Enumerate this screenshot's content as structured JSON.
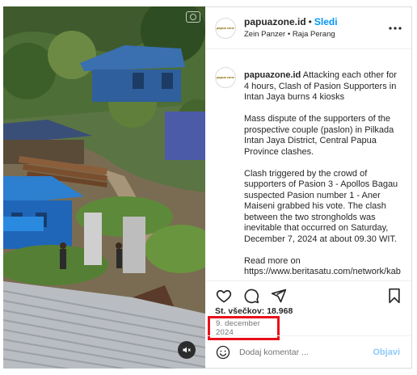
{
  "post": {
    "account": {
      "username": "papuazone.id",
      "follow_label": "Sledi",
      "separator": "•",
      "subline": "Zein Panzer • Raja Perang",
      "avatar_text": "papua zone"
    },
    "caption": {
      "username": "papuazone.id",
      "paragraphs": [
        "Attacking each other for 4 hours, Clash of Pasion Supporters in Intan Jaya burns 4 kiosks",
        "Mass dispute of the supporters of the prospective couple (paslon) in Pilkada Intan Jaya District, Central Papua Province clashes.",
        "Clash triggered by the crowd of supporters of Pasion 3 - Apollos Bagau suspected Pasion number 1 - Aner Maiseni grabbed his vote. The clash between the two strongholds was inevitable that occurred on Saturday, December 7, 2024 at about 09.30 WIT.",
        "Read more on https://www.beritasatu.com/network/kab"
      ]
    },
    "likes_text": "Št. všečkov: 18.968",
    "date": "9. december 2024",
    "comment": {
      "placeholder": "Dodaj komentar ...",
      "post_label": "Objavi"
    }
  },
  "icons": {
    "more": "more-options-icon",
    "like": "heart-icon",
    "comment": "comment-icon",
    "share": "share-icon",
    "save": "bookmark-icon",
    "emoji": "emoji-icon",
    "mute": "speaker-muted-icon",
    "camera": "camera-icon"
  },
  "colors": {
    "follow": "#0095f6",
    "highlight_box": "#e8101a",
    "post_button": "#8dcaf9"
  }
}
